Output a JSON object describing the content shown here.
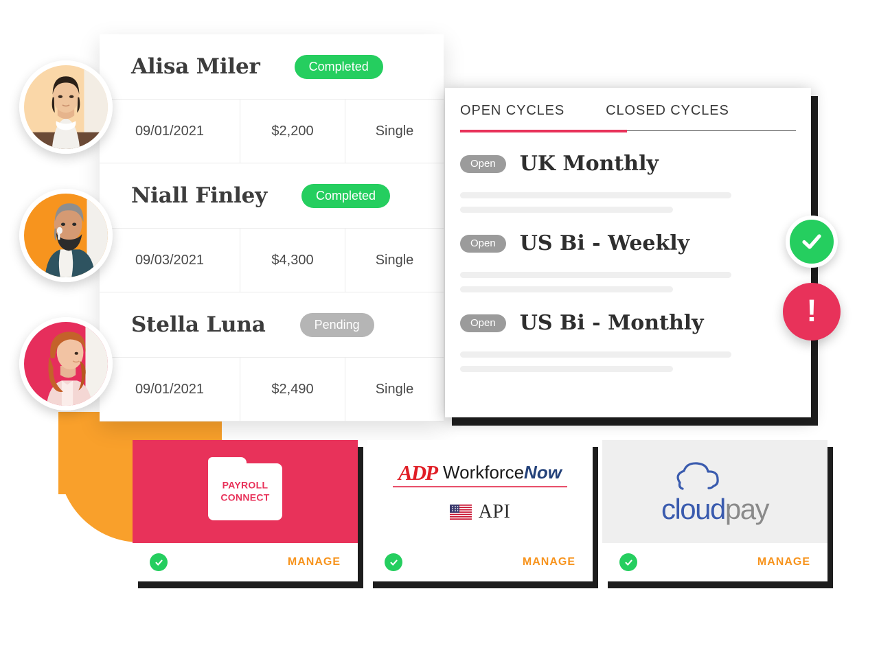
{
  "employee_table": {
    "rows": [
      {
        "name": "Alisa Miler",
        "status": "Completed",
        "status_type": "completed",
        "date": "09/01/2021",
        "amount": "$2,200",
        "type": "Single",
        "avatar_bg": "#FAD7A8"
      },
      {
        "name": "Niall Finley",
        "status": "Completed",
        "status_type": "completed",
        "date": "09/03/2021",
        "amount": "$4,300",
        "type": "Single",
        "avatar_bg": "#F7941E"
      },
      {
        "name": "Stella Luna",
        "status": "Pending",
        "status_type": "pending",
        "date": "09/01/2021",
        "amount": "$2,490",
        "type": "Single",
        "avatar_bg": "#E62E5C"
      }
    ]
  },
  "cycles_panel": {
    "tabs": [
      {
        "label": "OPEN CYCLES",
        "active": true
      },
      {
        "label": "CLOSED CYCLES",
        "active": false
      }
    ],
    "items": [
      {
        "badge": "Open",
        "name": "UK Monthly"
      },
      {
        "badge": "Open",
        "name": "US Bi - Weekly"
      },
      {
        "badge": "Open",
        "name": "US Bi - Monthly"
      }
    ]
  },
  "badges": {
    "success_icon": "check-circle-icon",
    "alert_icon": "exclamation-circle-icon",
    "alert_glyph": "!"
  },
  "integrations": {
    "manage_label": "MANAGE",
    "cards": [
      {
        "id": "payroll-connect",
        "logo_line1": "PAYROLL",
        "logo_line2": "CONNECT",
        "connected": true
      },
      {
        "id": "adp-workforce-now",
        "brand_mark": "ADP",
        "brand_word": "Workforce",
        "brand_word_italic": "Now",
        "api_label": "API",
        "flag": "us-flag-icon",
        "connected": true
      },
      {
        "id": "cloudpay",
        "word_primary": "cloud",
        "word_secondary": "pay",
        "connected": true
      }
    ]
  },
  "colors": {
    "green": "#25CE5F",
    "crimson": "#E8325A",
    "orange": "#F7941E",
    "gray_pill": "#9B9B9B",
    "adp_red": "#E01E26",
    "adp_navy": "#24427A",
    "cloudpay_blue": "#3A5BAE",
    "cloudpay_gray": "#8A8A8A"
  }
}
